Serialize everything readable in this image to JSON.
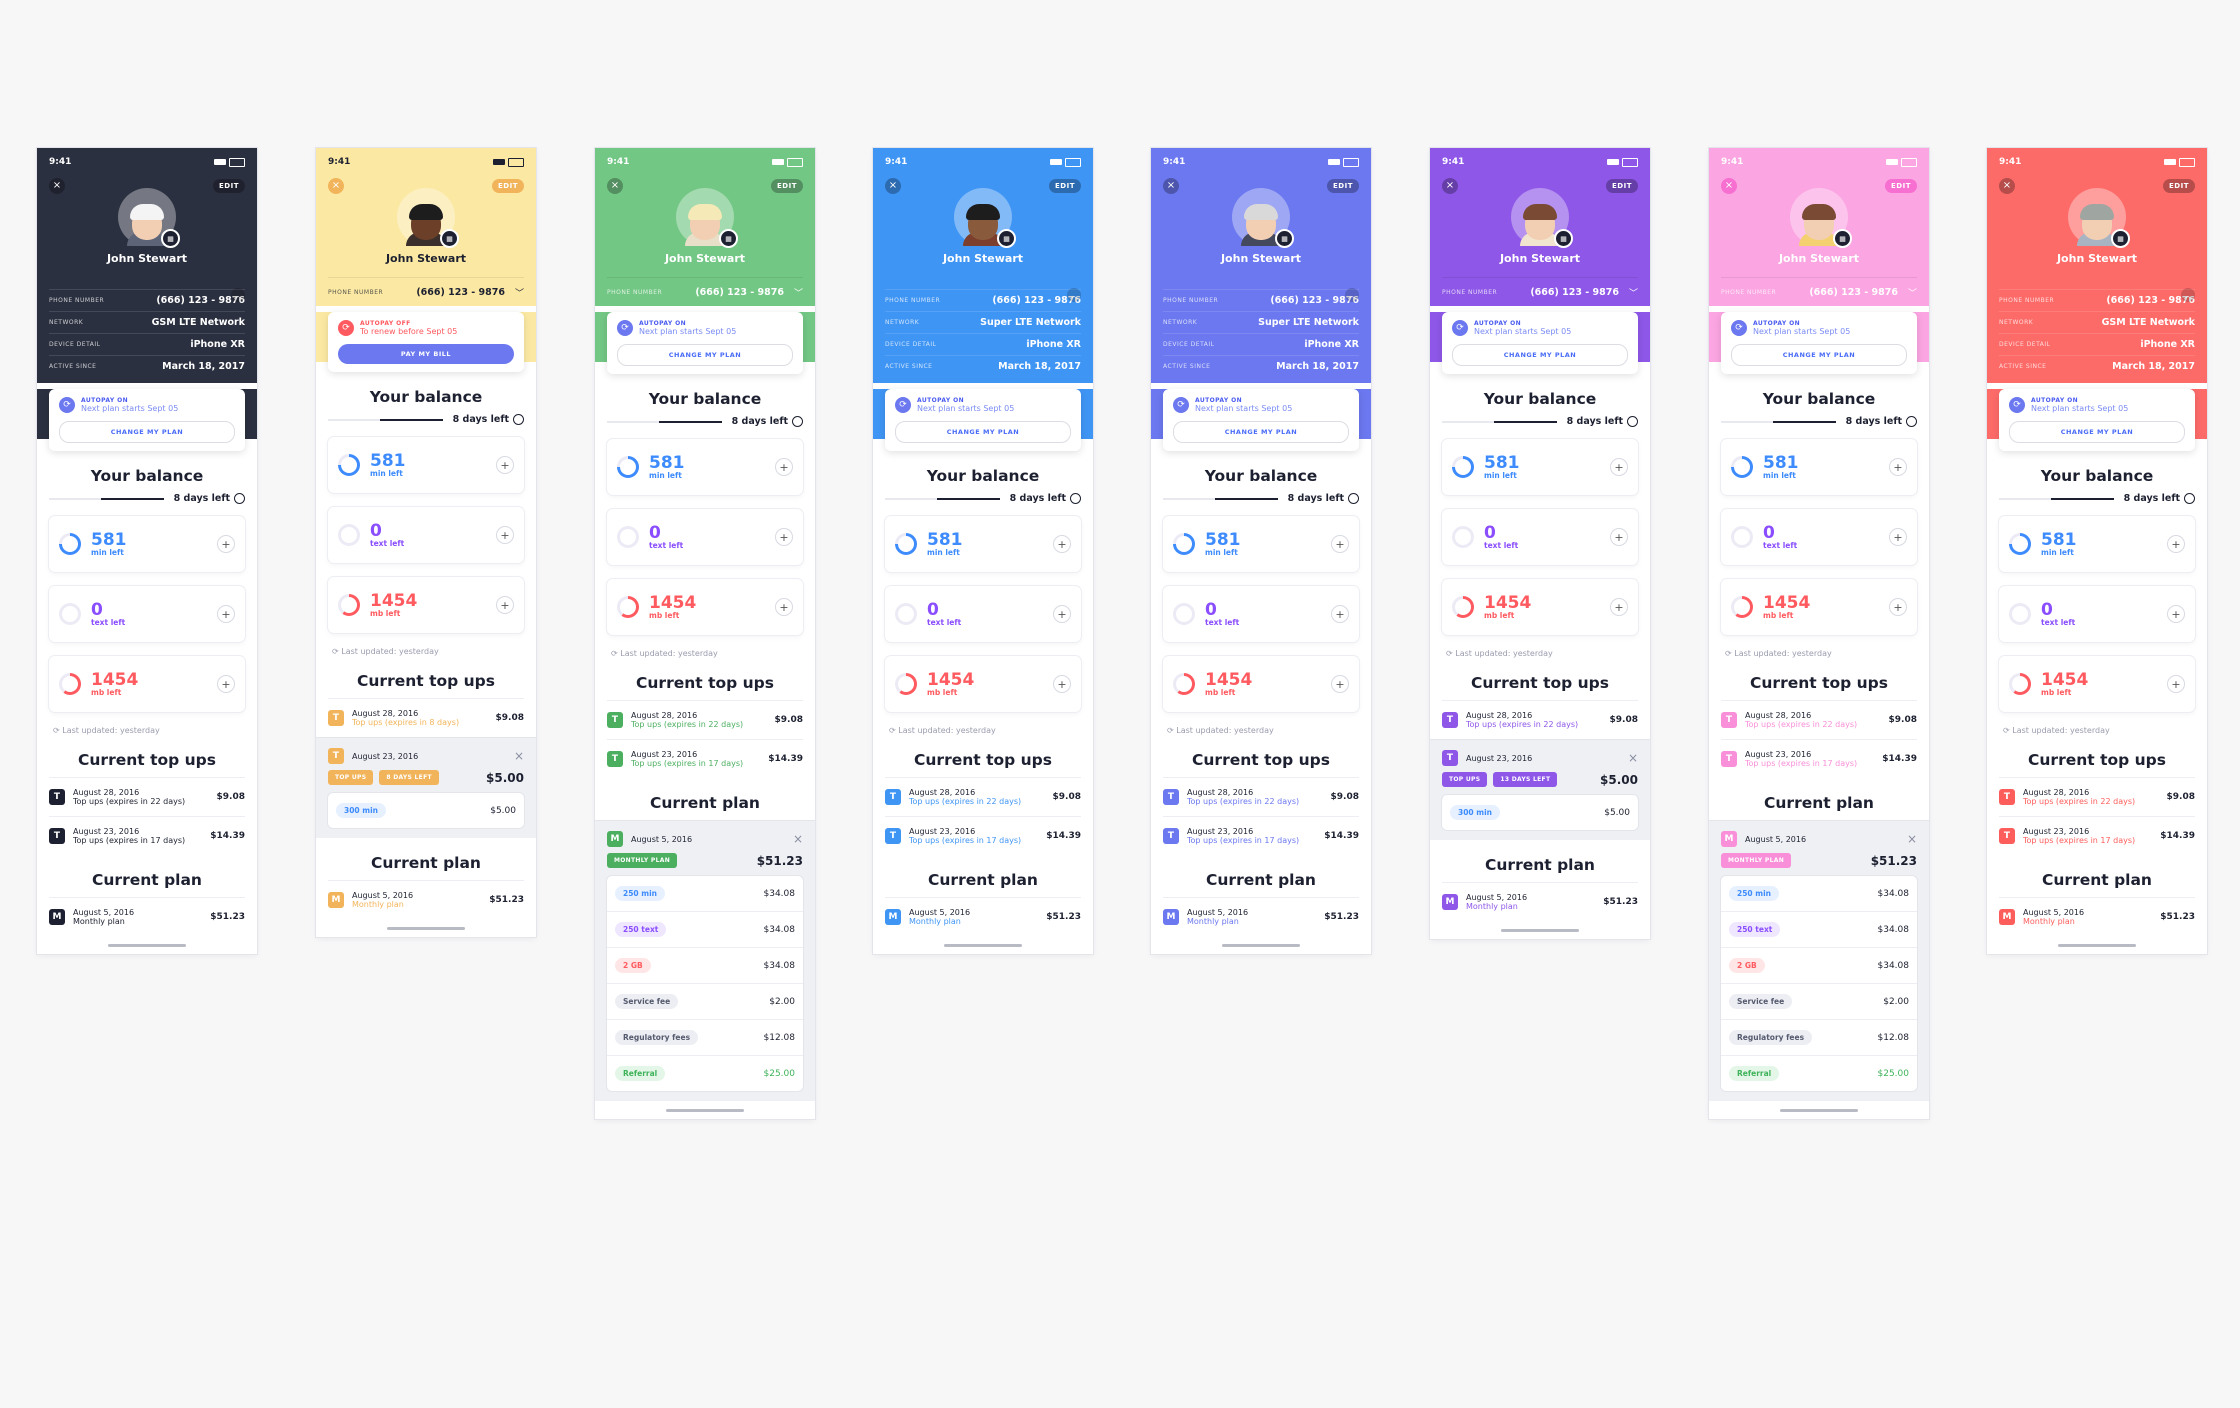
{
  "status_time": "9:41",
  "user_name": "John Stewart",
  "edit_label": "EDIT",
  "close_glyph": "×",
  "info_labels": {
    "phone": "PHONE NUMBER",
    "network": "NETWORK",
    "device": "DEVICE DETAIL",
    "active": "ACTIVE SINCE"
  },
  "phone_number": "(666) 123 - 9876",
  "device": "iPhone XR",
  "active_since": "March 18, 2017",
  "autopay_on": "AUTOPAY ON",
  "autopay_off": "AUTOPAY OFF",
  "next_plan": "Next plan starts Sept 05",
  "renew_before": "To renew before Sept 05",
  "change_plan": "CHANGE MY PLAN",
  "pay_bill": "PAY MY BILL",
  "your_balance": "Your balance",
  "days_left": "8 days left",
  "balance": [
    {
      "value": "581",
      "label": "min left",
      "color": "#3d8bfd"
    },
    {
      "value": "0",
      "label": "text left",
      "color": "#8a4dff"
    },
    {
      "value": "1454",
      "label": "mb left",
      "color": "#ff5a5f"
    }
  ],
  "last_updated": "Last updated: yesterday",
  "current_top_ups": "Current top ups",
  "topups": [
    {
      "icon": "T",
      "date": "August 28, 2016",
      "sub": "Top ups (expires in 22 days)",
      "amount": "$9.08"
    },
    {
      "icon": "T",
      "date": "August 23, 2016",
      "sub": "Top ups (expires in 17 days)",
      "amount": "$14.39"
    }
  ],
  "yellow_topup_sub": "Top ups (expires in 8 days)",
  "current_plan": "Current plan",
  "plan": {
    "icon": "M",
    "date": "August 5, 2016",
    "sub": "Monthly plan",
    "amount": "$51.23"
  },
  "topup_pill": "TOP UPS",
  "days_pill_yellow": "8 DAYS LEFT",
  "days_pill_purple": "13 DAYS LEFT",
  "topup_total": "$5.00",
  "topup_item": {
    "tag": "300 min",
    "amount": "$5.00"
  },
  "monthly_pill": "MONTHLY PLAN",
  "plan_items": [
    {
      "tag": "250 min",
      "amount": "$34.08",
      "bg": "#e6f0ff",
      "fg": "#3d8bfd"
    },
    {
      "tag": "250 text",
      "amount": "$34.08",
      "bg": "#efe6ff",
      "fg": "#8a4dff"
    },
    {
      "tag": "2 GB",
      "amount": "$34.08",
      "bg": "#ffe6e6",
      "fg": "#ff5a5f"
    },
    {
      "tag": "Service fee",
      "amount": "$2.00",
      "bg": "#eceef3",
      "fg": "#555a6e"
    },
    {
      "tag": "Regulatory fees",
      "amount": "$12.08",
      "bg": "#eceef3",
      "fg": "#555a6e"
    },
    {
      "tag": "Referral",
      "amount": "$25.00",
      "bg": "#e3f6e7",
      "fg": "#3fb35a"
    }
  ],
  "phones": [
    {
      "theme": "dark",
      "bg": "#2b3040",
      "fg": "#ffffff",
      "accent": "#1d2030",
      "network": "GSM LTE Network"
    },
    {
      "theme": "yellow",
      "bg": "#fbe9a3",
      "fg": "#1d2030",
      "accent": "#f2b45a",
      "network": ""
    },
    {
      "theme": "green",
      "bg": "#73c785",
      "fg": "#ffffff",
      "accent": "#4caf60",
      "network": ""
    },
    {
      "theme": "blue",
      "bg": "#3f95f4",
      "fg": "#ffffff",
      "accent": "#3f95f4",
      "network": "Super LTE Network"
    },
    {
      "theme": "indigo",
      "bg": "#6b78ef",
      "fg": "#ffffff",
      "accent": "#6b78ef",
      "network": "Super LTE Network"
    },
    {
      "theme": "purple",
      "bg": "#8e57e8",
      "fg": "#ffffff",
      "accent": "#8e57e8",
      "network": ""
    },
    {
      "theme": "pink",
      "bg": "#fba5e2",
      "fg": "#ffffff",
      "accent": "#f98fd8",
      "network": ""
    },
    {
      "theme": "red",
      "bg": "#fd6b69",
      "fg": "#ffffff",
      "accent": "#fd5e5c",
      "network": "GSM LTE Network"
    }
  ]
}
